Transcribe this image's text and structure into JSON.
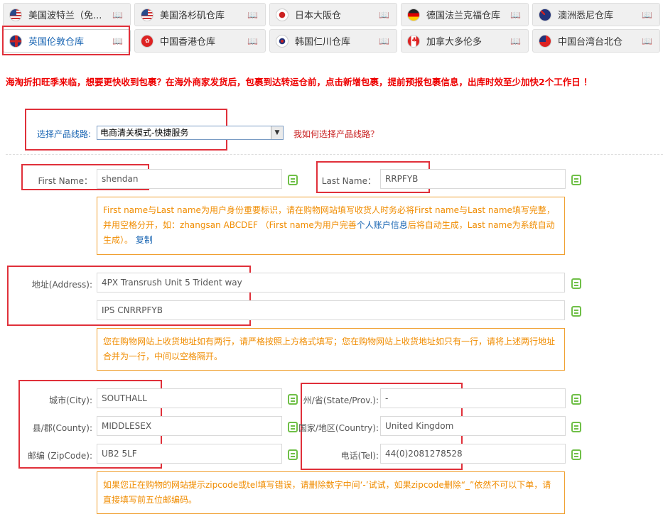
{
  "tabs": [
    {
      "label": "美国波特兰（免...",
      "flag": "us"
    },
    {
      "label": "美国洛杉矶仓库",
      "flag": "us"
    },
    {
      "label": "日本大阪仓",
      "flag": "jp"
    },
    {
      "label": "德国法兰克福仓库",
      "flag": "de"
    },
    {
      "label": "澳洲悉尼仓库",
      "flag": "au"
    },
    {
      "label": "英国伦敦仓库",
      "flag": "gb"
    },
    {
      "label": "中国香港仓库",
      "flag": "hk"
    },
    {
      "label": "韩国仁川仓库",
      "flag": "kr"
    },
    {
      "label": "加拿大多伦多",
      "flag": "ca"
    },
    {
      "label": "中国台湾台北仓",
      "flag": "tw"
    }
  ],
  "notice": "海淘折扣旺季来临，想要更快收到包裹？在海外商家发货后，包裹到达转运仓前，点击新增包裹，提前预报包裹信息，出库时效至少加快2个工作日 ！",
  "route": {
    "label": "选择产品线路:",
    "selected": "电商清关模式-快捷服务",
    "help_link": "我如何选择产品线路？"
  },
  "form": {
    "first_name_label": "First Name：",
    "first_name": "shendan",
    "last_name_label": "Last Name：",
    "last_name": "RRPFYB",
    "address_label": "地址(Address):",
    "address1": "4PX Transrush Unit 5 Trident way",
    "address2": "IPS CNRRPFYB",
    "city_label": "城市(City):",
    "city": "SOUTHALL",
    "state_label": "州/省(State/Prov.):",
    "state": "-",
    "county_label": "县/郡(County):",
    "county": "MIDDLESEX",
    "country_label": "国家/地区(Country):",
    "country": "United Kingdom",
    "zip_label": "邮编 (ZipCode):",
    "zip": "UB2 5LF",
    "tel_label": "电话(Tel):",
    "tel": "44(0)2081278528"
  },
  "tips": {
    "name_tip_a": "First name与Last name为用户身份重要标识，请在购物网站填写收货人时务必将First name与Last name填写完整，并用空格分开，如：zhangsan ABCDEF （First name为用户完善",
    "name_tip_link": "个人账户信息",
    "name_tip_b": "后将自动生成，Last name为系统自动生成）。",
    "name_tip_copy": "复制",
    "address_tip": "您在购物网站上收货地址如有两行，请严格按照上方格式填写；您在购物网站上收货地址如只有一行，请将上述两行地址合并为一行，中间以空格隔开。",
    "zip_tip": "如果您正在购物的网站提示zipcode或tel填写错误，请删除数字中间‘-’试试，如果zipcode删除“_”依然不可以下单，请直接填写前五位邮编码。"
  },
  "colors": {
    "accent_red": "#e0303a",
    "notice_red": "#ee0000",
    "tip_orange": "#f08c00",
    "link_blue": "#1a66b3",
    "copy_green": "#6fbf47"
  }
}
